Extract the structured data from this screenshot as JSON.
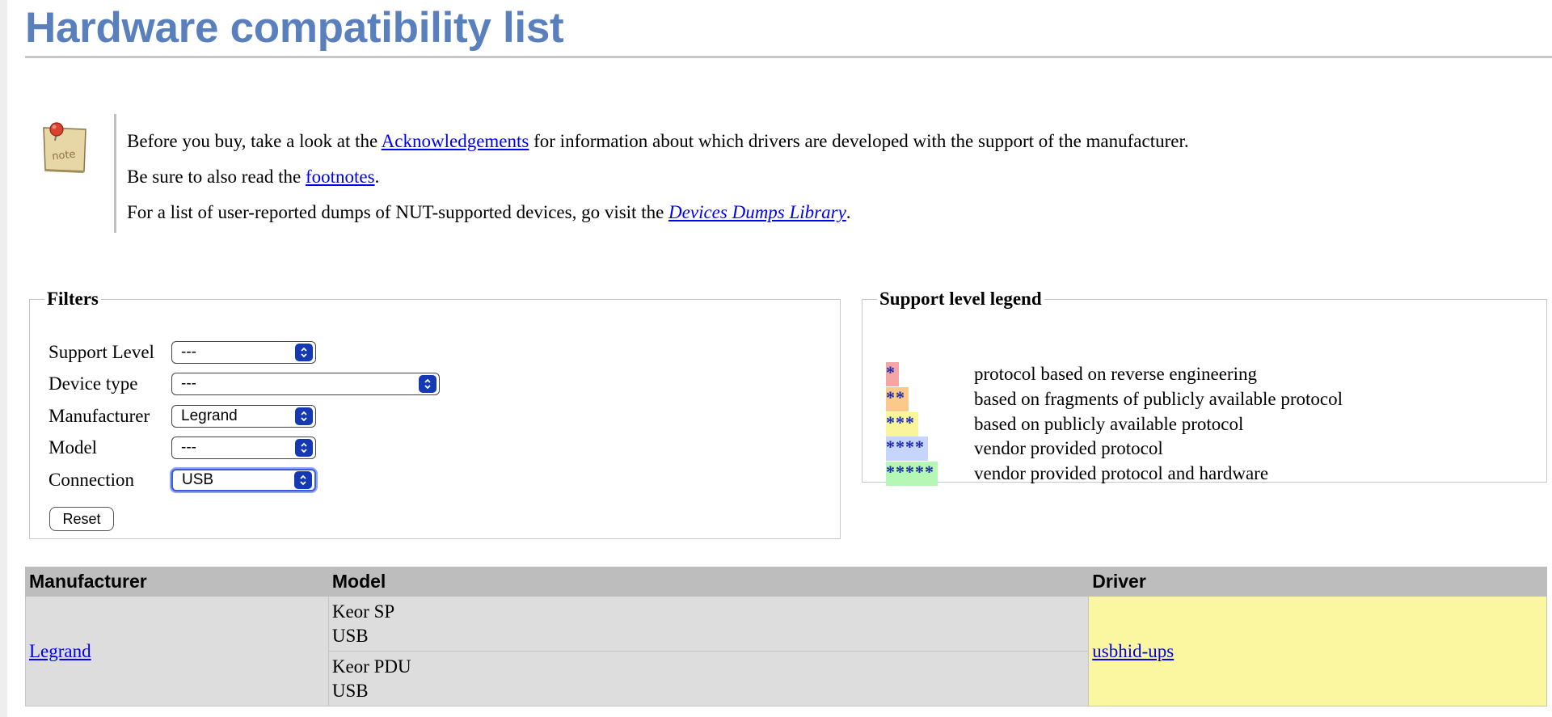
{
  "page": {
    "title": "Hardware compatibility list"
  },
  "note": {
    "icon": "note-icon",
    "icon_label": "note",
    "line1_prefix": "Before you buy, take a look at the ",
    "line1_link": "Acknowledgements",
    "line1_suffix": " for information about which drivers are developed with the support of the manufacturer.",
    "line2_prefix": "Be sure to also read the ",
    "line2_link": "footnotes",
    "line2_suffix": ".",
    "line3_prefix": "For a list of user-reported dumps of NUT-supported devices, go visit the ",
    "line3_link": "Devices Dumps Library",
    "line3_suffix": "."
  },
  "filters": {
    "legend": "Filters",
    "support_level": {
      "label": "Support Level",
      "value": "---"
    },
    "device_type": {
      "label": "Device type",
      "value": "---"
    },
    "manufacturer": {
      "label": "Manufacturer",
      "value": "Legrand"
    },
    "model": {
      "label": "Model",
      "value": "---"
    },
    "connection": {
      "label": "Connection",
      "value": "USB"
    },
    "reset_label": "Reset"
  },
  "support_legend": {
    "title": "Support level legend",
    "items": [
      {
        "stars": "*",
        "description": "protocol based on reverse engineering",
        "color": "#f4a6a6"
      },
      {
        "stars": "**",
        "description": "based on fragments of publicly available protocol",
        "color": "#fbc98a"
      },
      {
        "stars": "***",
        "description": "based on publicly available protocol",
        "color": "#f9f59b"
      },
      {
        "stars": "****",
        "description": "vendor provided protocol",
        "color": "#c7d4fb"
      },
      {
        "stars": "*****",
        "description": "vendor provided protocol and hardware",
        "color": "#b5f7b5"
      }
    ]
  },
  "table": {
    "headers": [
      "Manufacturer",
      "Model",
      "Driver"
    ],
    "rows": [
      {
        "manufacturer": "Legrand",
        "models": [
          {
            "name": "Keor SP",
            "connection": "USB"
          },
          {
            "name": "Keor PDU",
            "connection": "USB"
          }
        ],
        "driver": "usbhid-ups",
        "driver_color": "#fbf7a1"
      }
    ]
  }
}
